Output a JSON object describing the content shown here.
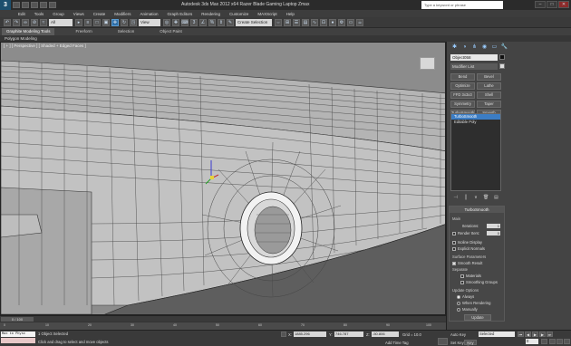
{
  "title_bar": {
    "logo_letter": "3",
    "title": "Autodesk 3ds Max 2012 x64    Razer Blade Gaming Laptop Zmax",
    "search_placeholder": "Type a keyword or phrase",
    "minimize": "–",
    "maximize": "□",
    "close": "✕"
  },
  "menu": {
    "items": [
      "Edit",
      "Tools",
      "Group",
      "Views",
      "Create",
      "Modifiers",
      "Animation",
      "Graph Editors",
      "Rendering",
      "Customize",
      "MAXScript",
      "Help"
    ]
  },
  "toolbar": {
    "undo_label": "Undo",
    "all_dropdown": "All",
    "view_dropdown": "View",
    "selection_set": "Create Selection Se"
  },
  "ribbon": {
    "tabs": [
      "Graphite Modeling Tools",
      "Freeform",
      "Selection",
      "Object Paint"
    ],
    "active_tab": "Graphite Modeling Tools",
    "panel_label": "Polygon Modeling"
  },
  "viewport": {
    "label": "[ + ] [ Perspective ] [ Shaded + Edged Faces ]"
  },
  "command_panel": {
    "object_name": "Object058",
    "modifier_list": "Modifier List",
    "modifier_buttons": [
      {
        "label": "Bend"
      },
      {
        "label": "Bevel"
      },
      {
        "label": "Optimize"
      },
      {
        "label": "Lathe"
      },
      {
        "label": "FFD 3x3x3"
      },
      {
        "label": "Shell"
      },
      {
        "label": "Symmetry"
      },
      {
        "label": "Taper"
      },
      {
        "label": "TurboSmooth"
      },
      {
        "label": "Smooth"
      }
    ],
    "stack_items": [
      "TurboSmooth",
      "Editable Poly"
    ],
    "stack_selected": "TurboSmooth",
    "rollout": {
      "title": "TurboSmooth",
      "main_label": "Main",
      "iterations_label": "Iterations:",
      "iterations_value": "1",
      "render_iters_label": "Render Iters:",
      "render_iters_value": "0",
      "isoline_label": "Isoline Display",
      "explicit_normals_label": "Explicit Normals",
      "surface_params_label": "Surface Parameters",
      "smooth_result_label": "Smooth Result",
      "separate_label": "Separate",
      "materials_label": "Materials",
      "smoothing_groups_label": "Smoothing Groups",
      "update_options_label": "Update Options",
      "always_label": "Always",
      "when_rendering_label": "When Rendering",
      "manually_label": "Manually",
      "update_button": "Update"
    }
  },
  "timeline": {
    "slider_label": "0 / 100",
    "ticks": [
      "0",
      "10",
      "20",
      "30",
      "40",
      "50",
      "60",
      "70",
      "80",
      "90",
      "100"
    ]
  },
  "status_bar": {
    "maxscript_line1": "Max to Physc",
    "maxscript_line2": "",
    "line1": "1 Object Selected",
    "line2": "Click and drag to select and move objects",
    "x_label": "X:",
    "x_value": "1885.296",
    "y_label": "Y:",
    "y_value": "746.787",
    "z_label": "Z:",
    "z_value": "-50.806",
    "grid_label": "Grid = 10.0",
    "add_time_tag": "Add Time Tag",
    "auto_key": "Auto Key",
    "selected_dropdown": "Selected",
    "set_key": "Set Key",
    "key_filters": "Key Filters...",
    "frame_value": "0"
  }
}
